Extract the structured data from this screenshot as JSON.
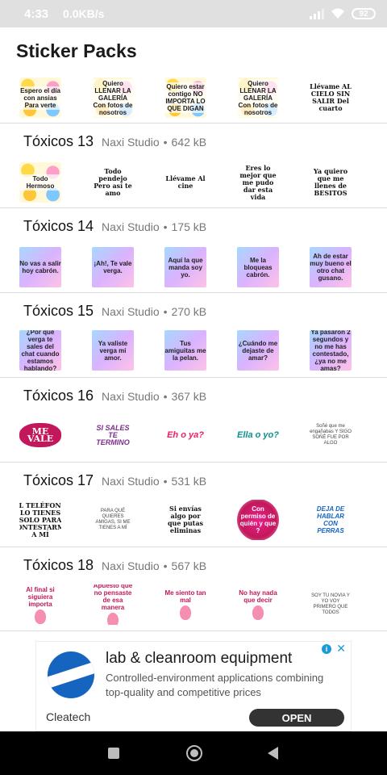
{
  "status_bar": {
    "time": "4:33",
    "net_speed": "0.0KB/s",
    "battery": "92"
  },
  "app": {
    "title": "Sticker Packs"
  },
  "first_pack": {
    "stickers": [
      {
        "text": "Espero el día con ansias Para verte",
        "style": "emoji"
      },
      {
        "text": "Quiero LLENAR LA GALERÍA Con fotos de nosotros",
        "style": "emoji"
      },
      {
        "text": "Quiero estar contigo NO IMPORTA LO QUE DIGAN",
        "style": "emoji"
      },
      {
        "text": "Quiero LLENAR LA GALERÍA Con fotos de nosotros",
        "style": "emoji"
      },
      {
        "text": "Llévame AL CIELO SIN SALIR Del cuarto",
        "style": "plain"
      }
    ]
  },
  "packs": [
    {
      "name": "Tóxicos 13",
      "publisher": "Naxi Studio",
      "size": "642 kB",
      "stickers": [
        {
          "text": "Todo Hermoso",
          "style": "emoji"
        },
        {
          "text": "Todo pendejo Pero así te amo",
          "style": "plain"
        },
        {
          "text": "Llévame Al cine",
          "style": "plain"
        },
        {
          "text": "Eres lo mejor que me pudo dar esta vida",
          "style": "plain"
        },
        {
          "text": "Ya quiero que me llenes de BESITOS",
          "style": "plain"
        }
      ]
    },
    {
      "name": "Tóxicos 14",
      "publisher": "Naxi Studio",
      "size": "175 kB",
      "stickers": [
        {
          "text": "No vas a salir hoy cabrón.",
          "style": "pastel"
        },
        {
          "text": "¡Ah!, Te vale verga.",
          "style": "pastel"
        },
        {
          "text": "Aquí la que manda soy yo.",
          "style": "pastel"
        },
        {
          "text": "Me la bloqueas cabrón.",
          "style": "pastel"
        },
        {
          "text": "Ah de estar muy bueno el otro chat gusano.",
          "style": "pastel"
        }
      ]
    },
    {
      "name": "Tóxicos 15",
      "publisher": "Naxi Studio",
      "size": "270 kB",
      "stickers": [
        {
          "text": "¿Por qué verga te sales del chat cuando estamos hablando?",
          "style": "pastel"
        },
        {
          "text": "Ya valiste verga mi amor.",
          "style": "pastel"
        },
        {
          "text": "Tus amiguitas me la pelan.",
          "style": "pastel"
        },
        {
          "text": "¿Cuándo me dejaste de amar?",
          "style": "pastel"
        },
        {
          "text": "Ya pasaron 2 segundos y no me has contestado, ¿ya no me amas?",
          "style": "pastel"
        }
      ]
    },
    {
      "name": "Tóxicos 16",
      "publisher": "Naxi Studio",
      "size": "367 kB",
      "stickers": [
        {
          "text": "ME VALE",
          "style": "brush"
        },
        {
          "text": "SI SALES TE TERMINO",
          "style": "script"
        },
        {
          "text": "Eh o ya?",
          "style": "pink"
        },
        {
          "text": "Ella o yo?",
          "style": "teal"
        },
        {
          "text": "Soñé que me engañabas Y SIGO SOÑÉ FUE POR ALGO",
          "style": "tiny"
        }
      ]
    },
    {
      "name": "Tóxicos 17",
      "publisher": "Naxi Studio",
      "size": "531 kB",
      "stickers": [
        {
          "text": "EL TELÉFONO LO TIENES SOLO PARA CONTESTARME A MÍ",
          "style": "plain"
        },
        {
          "text": "PARA QUÉ QUIERES AMIGAS, SI ME TIENES A MÍ",
          "style": "tiny"
        },
        {
          "text": "Si envías algo por que putas eliminas",
          "style": "plain"
        },
        {
          "text": "Con permiso de quién y que ?",
          "style": "pinkblob"
        },
        {
          "text": "DEJA DE HABLAR CON PERRAS",
          "style": "blue"
        }
      ]
    },
    {
      "name": "Tóxicos 18",
      "publisher": "Naxi Studio",
      "size": "567 kB",
      "stickers": [
        {
          "text": "Al final si siguiera importa",
          "style": "guitar"
        },
        {
          "text": "Apuesto que no pensaste de esa manera",
          "style": "guitar"
        },
        {
          "text": "Me siento tan mal",
          "style": "guitar"
        },
        {
          "text": "No hay nada que decir",
          "style": "guitar"
        },
        {
          "text": "SOY TU NOVIA Y YO VOY PRIMERO QUE TODOS",
          "style": "tiny"
        }
      ]
    }
  ],
  "ad": {
    "title": "lab & cleanroom equipment",
    "description": "Controlled-environment applications combining top-quality and competitive prices",
    "advertiser": "Cleatech",
    "cta": "OPEN",
    "info_icon": "i",
    "close_icon": "✕"
  },
  "colors": {
    "accent": "#c2185b",
    "divider": "#dcdcdc",
    "ad_button": "#333333"
  }
}
